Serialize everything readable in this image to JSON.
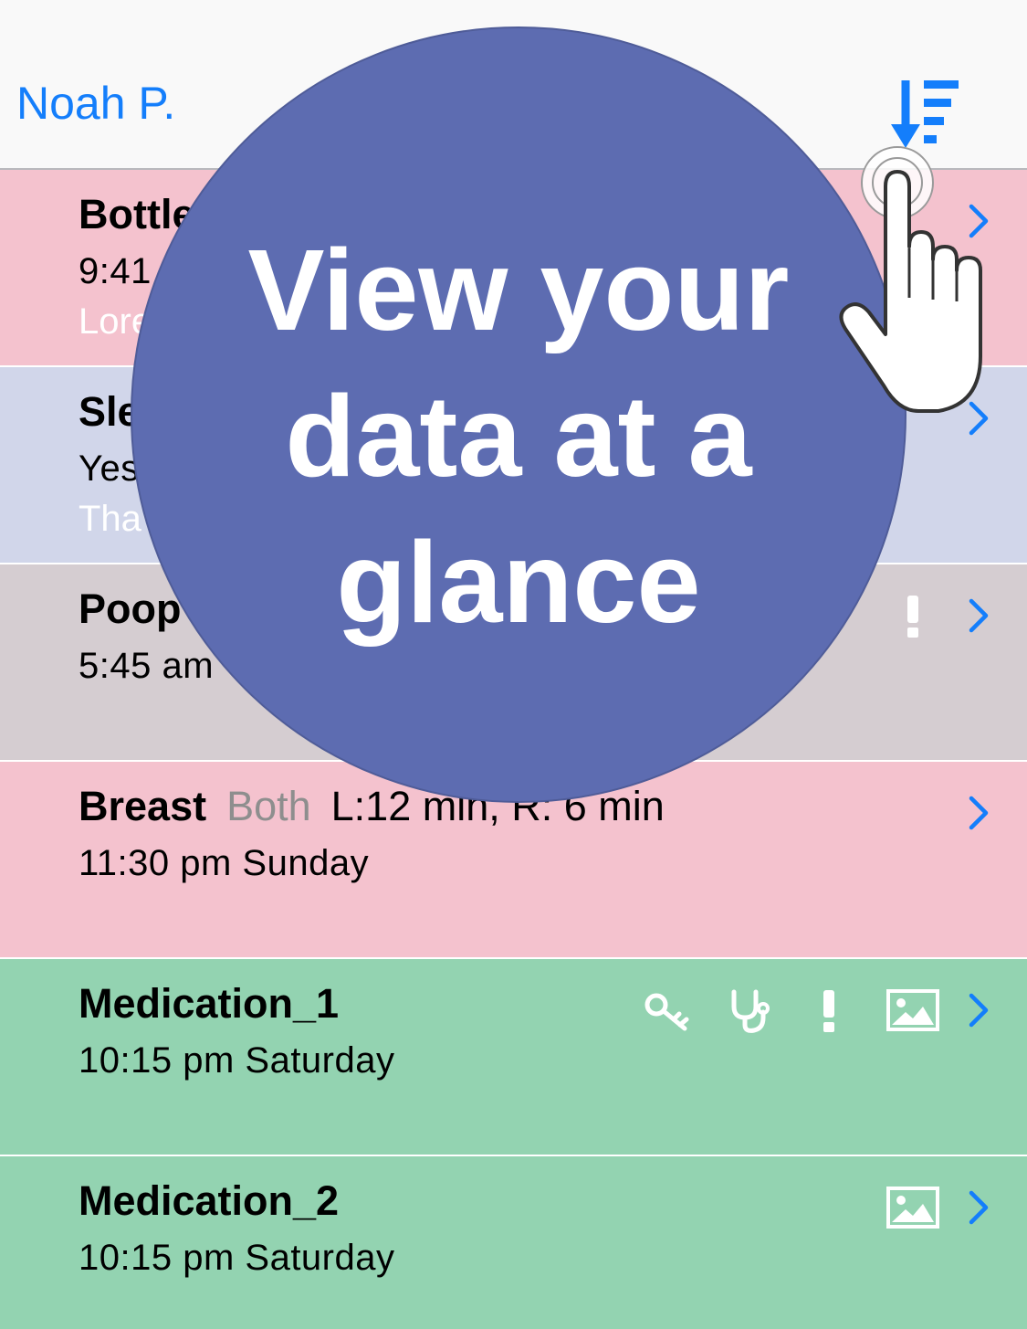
{
  "nav": {
    "title": "Noah P.",
    "sort_icon": "sort-descending-icon",
    "accent": "#147efb"
  },
  "rows": [
    {
      "title": "Bottle",
      "time": "9:41",
      "note": "Lore",
      "color": "#f4c2ce"
    },
    {
      "title": "Sle",
      "time": "Yes",
      "note": "Tha",
      "color": "#d1d6ea"
    },
    {
      "title": "Poop",
      "time": "5:45 am",
      "note": "",
      "color": "#d5cdd1"
    },
    {
      "title": "Breast",
      "sub": "Both",
      "detail": "L:12 min, R: 6 min",
      "time": "11:30 pm Sunday",
      "color": "#f4c2ce"
    },
    {
      "title": "Medication_1",
      "time": "10:15 pm Saturday",
      "color": "#93d3b1"
    },
    {
      "title": "Medication_2",
      "time": "10:15 pm Saturday",
      "color": "#93d3b1"
    }
  ],
  "overlay": {
    "headline_1": "View your",
    "headline_2": "data at a",
    "headline_3": "glance",
    "bubble_color": "#5d6cb1"
  },
  "icons": {
    "key": "key-icon",
    "stethoscope": "stethoscope-icon",
    "alert": "exclamation-icon",
    "photo": "photo-icon",
    "chevron": "chevron-right-icon",
    "hand": "pointing-hand-icon"
  }
}
